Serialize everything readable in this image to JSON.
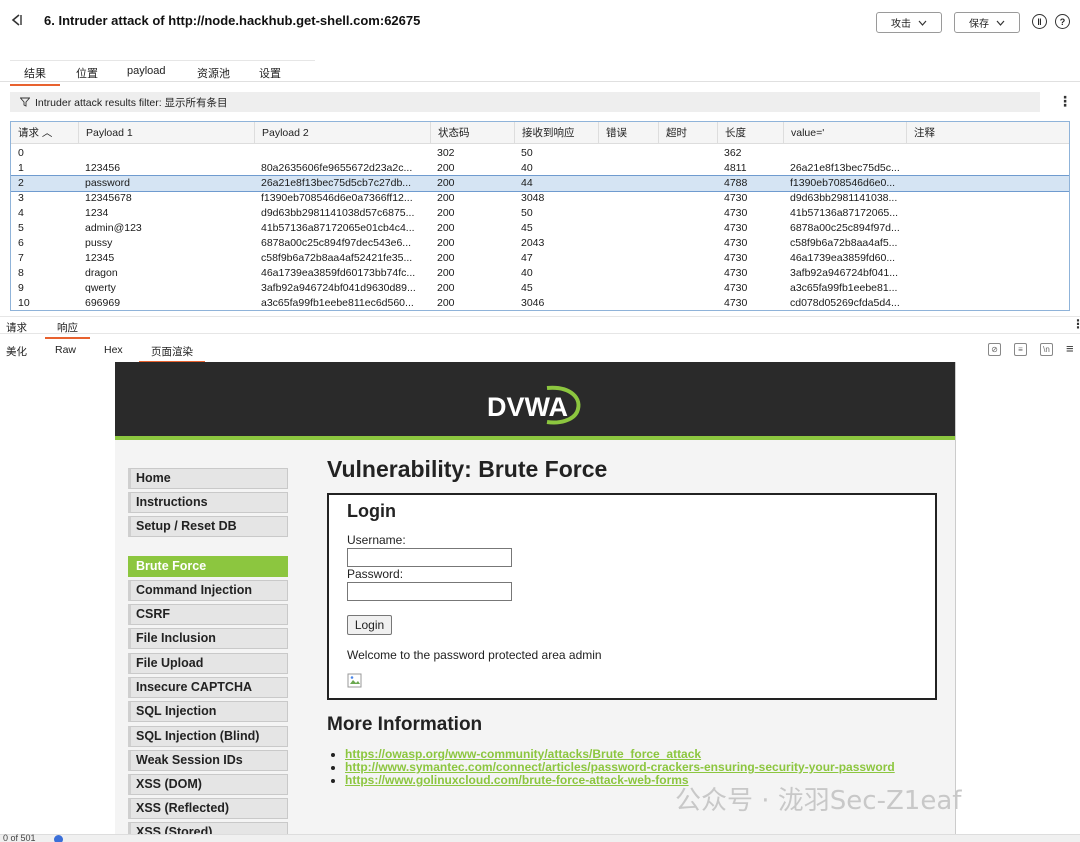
{
  "window": {
    "title": "6. Intruder attack of http://node.hackhub.get-shell.com:62675",
    "attack_button": "攻击",
    "save_button": "保存"
  },
  "main_tabs": [
    "结果",
    "位置",
    "payload",
    "资源池",
    "设置"
  ],
  "filter": {
    "text": "Intruder attack results filter: 显示所有条目"
  },
  "table": {
    "columns": [
      "请求",
      "Payload 1",
      "Payload 2",
      "状态码",
      "接收到响应",
      "错误",
      "超时",
      "长度",
      "value='",
      "注释"
    ],
    "rows": [
      [
        "0",
        "",
        "",
        "302",
        "50",
        "",
        "",
        "362",
        "",
        ""
      ],
      [
        "1",
        "123456",
        "80a2635606fe9655672d23a2c...",
        "200",
        "40",
        "",
        "",
        "4811",
        "26a21e8f13bec75d5c...",
        ""
      ],
      [
        "2",
        "password",
        "26a21e8f13bec75d5cb7c27db...",
        "200",
        "44",
        "",
        "",
        "4788",
        "f1390eb708546d6e0...",
        ""
      ],
      [
        "3",
        "12345678",
        "f1390eb708546d6e0a7366ff12...",
        "200",
        "3048",
        "",
        "",
        "4730",
        "d9d63bb2981141038...",
        ""
      ],
      [
        "4",
        "1234",
        "d9d63bb2981141038d57c6875...",
        "200",
        "50",
        "",
        "",
        "4730",
        "41b57136a87172065...",
        ""
      ],
      [
        "5",
        "admin@123",
        "41b57136a87172065e01cb4c4...",
        "200",
        "45",
        "",
        "",
        "4730",
        "6878a00c25c894f97d...",
        ""
      ],
      [
        "6",
        "pussy",
        "6878a00c25c894f97dec543e6...",
        "200",
        "2043",
        "",
        "",
        "4730",
        "c58f9b6a72b8aa4af5...",
        ""
      ],
      [
        "7",
        "12345",
        "c58f9b6a72b8aa4af52421fe35...",
        "200",
        "47",
        "",
        "",
        "4730",
        "46a1739ea3859fd60...",
        ""
      ],
      [
        "8",
        "dragon",
        "46a1739ea3859fd60173bb74fc...",
        "200",
        "40",
        "",
        "",
        "4730",
        "3afb92a946724bf041...",
        ""
      ],
      [
        "9",
        "qwerty",
        "3afb92a946724bf041d9630d89...",
        "200",
        "45",
        "",
        "",
        "4730",
        "a3c65fa99fb1eebe81...",
        ""
      ],
      [
        "10",
        "696969",
        "a3c65fa99fb1eebe811ec6d560...",
        "200",
        "3046",
        "",
        "",
        "4730",
        "cd078d05269cfda5d4...",
        ""
      ]
    ],
    "selected_row": 2
  },
  "lower_tabs": [
    "请求",
    "响应"
  ],
  "view_tabs": [
    "美化",
    "Raw",
    "Hex",
    "页面渲染"
  ],
  "dvwa": {
    "logo": "DVWA",
    "menu": [
      "Home",
      "Instructions",
      "Setup / Reset DB",
      "Brute Force",
      "Command Injection",
      "CSRF",
      "File Inclusion",
      "File Upload",
      "Insecure CAPTCHA",
      "SQL Injection",
      "SQL Injection (Blind)",
      "Weak Session IDs",
      "XSS (DOM)",
      "XSS (Reflected)",
      "XSS (Stored)"
    ],
    "active_menu": "Brute Force",
    "page_title": "Vulnerability: Brute Force",
    "login_heading": "Login",
    "username_label": "Username:",
    "password_label": "Password:",
    "login_button": "Login",
    "welcome": "Welcome to the password protected area admin",
    "more_info_heading": "More Information",
    "links": [
      "https://owasp.org/www-community/attacks/Brute_force_attack",
      "http://www.symantec.com/connect/articles/password-crackers-ensuring-security-your-password",
      "https://www.golinuxcloud.com/brute-force-attack-web-forms"
    ]
  },
  "watermark": "公众号 · 泷羽Sec-Z1eaf",
  "status": "0 of 501"
}
